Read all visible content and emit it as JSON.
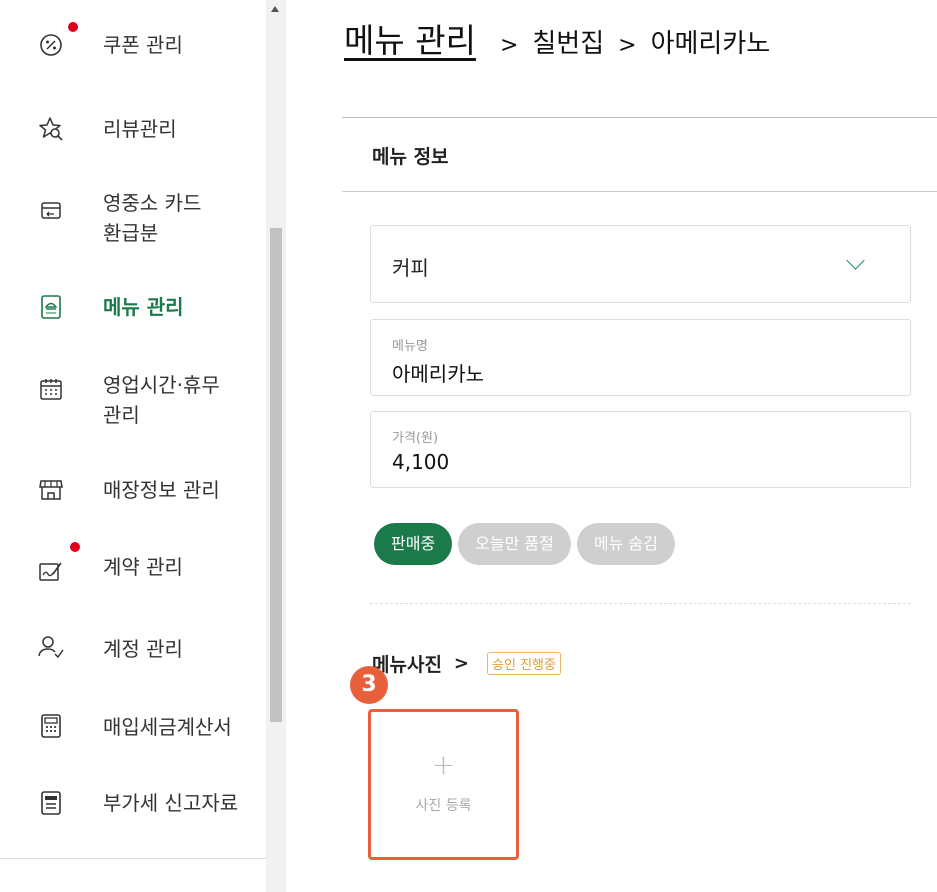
{
  "sidebar": {
    "items": [
      {
        "label": "쿠폰 관리",
        "icon": "coupon-icon",
        "has_dot": true
      },
      {
        "label": "리뷰관리",
        "icon": "review-star-icon",
        "has_dot": false
      },
      {
        "label": "영중소 카드\n환급분",
        "icon": "card-refund-icon",
        "has_dot": false
      },
      {
        "label": "메뉴 관리",
        "icon": "menu-board-icon",
        "has_dot": false,
        "active": true
      },
      {
        "label": "영업시간·휴무\n관리",
        "icon": "calendar-icon",
        "has_dot": false
      },
      {
        "label": "매장정보 관리",
        "icon": "store-icon",
        "has_dot": false
      },
      {
        "label": "계약 관리",
        "icon": "contract-icon",
        "has_dot": true
      },
      {
        "label": "계정 관리",
        "icon": "account-icon",
        "has_dot": false
      },
      {
        "label": "매입세금계산서",
        "icon": "calculator-icon",
        "has_dot": false
      },
      {
        "label": "부가세 신고자료",
        "icon": "vat-document-icon",
        "has_dot": false
      }
    ]
  },
  "breadcrumb": {
    "root": "메뉴 관리",
    "sep": ">",
    "store": "칠번집",
    "item": "아메리카노"
  },
  "menu_info": {
    "section_title": "메뉴 정보",
    "category": "커피",
    "name_label": "메뉴명",
    "name_value": "아메리카노",
    "price_label": "가격(원)",
    "price_value": "4,100"
  },
  "status_chips": [
    "판매중",
    "오늘만 품절",
    "메뉴 숨김"
  ],
  "photo": {
    "title": "메뉴사진",
    "arrow": ">",
    "badge": "승인 진행중",
    "step_number": "3",
    "plus": "+",
    "upload_label": "사진 등록"
  },
  "colors": {
    "accent_green": "#1a7a4a",
    "highlight_orange": "#e8603a",
    "notification_red": "#e3001b",
    "badge_orange": "#e39b3a"
  }
}
